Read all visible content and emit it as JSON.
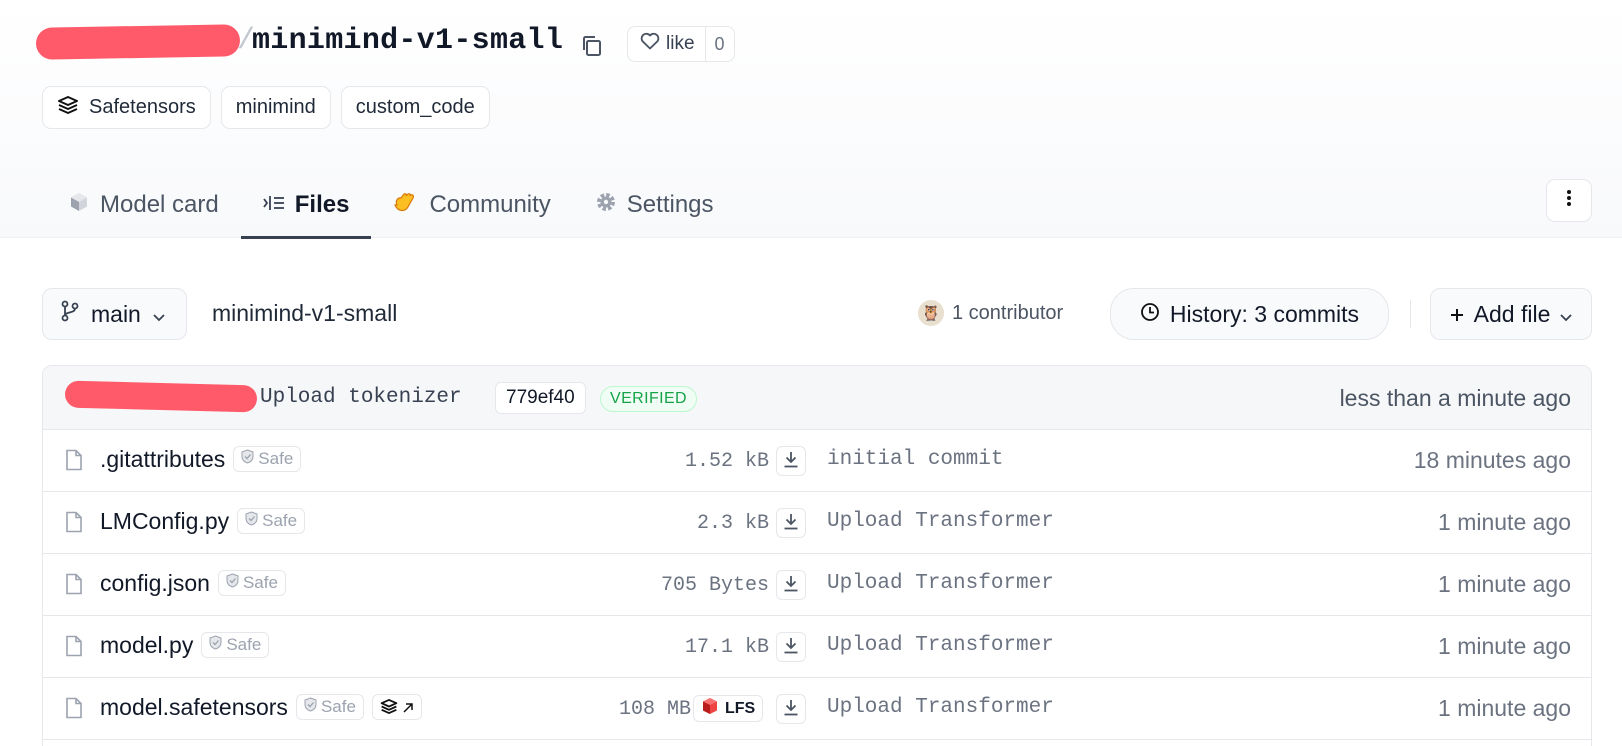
{
  "repo": {
    "name": "minimind-v1-small",
    "slash": "/",
    "like_label": "like",
    "like_count": "0"
  },
  "tags": [
    {
      "label": "Safetensors",
      "icon": "safetensors-icon"
    },
    {
      "label": "minimind"
    },
    {
      "label": "custom_code"
    }
  ],
  "tabs": [
    {
      "label": "Model card",
      "icon": "model-card-icon",
      "active": false
    },
    {
      "label": "Files",
      "icon": "files-icon",
      "active": true
    },
    {
      "label": "Community",
      "icon": "community-icon",
      "active": false
    },
    {
      "label": "Settings",
      "icon": "gear-icon",
      "active": false
    }
  ],
  "branch": {
    "name": "main",
    "path": "minimind-v1-small",
    "contributors": "1 contributor",
    "history": "History: 3 commits",
    "add_file": "Add file"
  },
  "last_commit": {
    "message": "Upload tokenizer",
    "hash": "779ef40",
    "verified": "VERIFIED",
    "time": "less than a minute ago"
  },
  "files": [
    {
      "name": ".gitattributes",
      "safe": "Safe",
      "size": "1.52 kB",
      "commit": "initial commit",
      "time": "18 minutes ago"
    },
    {
      "name": "LMConfig.py",
      "safe": "Safe",
      "size": "2.3 kB",
      "commit": "Upload Transformer",
      "time": "1 minute ago"
    },
    {
      "name": "config.json",
      "safe": "Safe",
      "size": "705 Bytes",
      "commit": "Upload Transformer",
      "time": "1 minute ago"
    },
    {
      "name": "model.py",
      "safe": "Safe",
      "size": "17.1 kB",
      "commit": "Upload Transformer",
      "time": "1 minute ago"
    },
    {
      "name": "model.safetensors",
      "safe": "Safe",
      "size": "108 MB",
      "lfs": "LFS",
      "commit": "Upload Transformer",
      "time": "1 minute ago"
    }
  ],
  "colors": {
    "redaction": "#fe5a6a",
    "verified_green": "#16a34a",
    "community_yellow": "#fbbf24",
    "lfs_red": "#dc2626"
  }
}
